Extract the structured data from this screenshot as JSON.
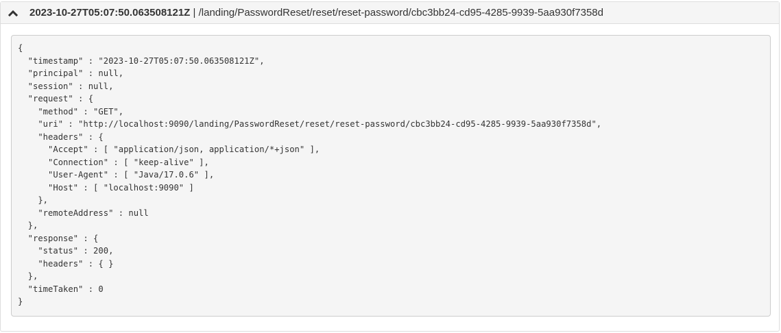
{
  "trace": {
    "timestamp": "2023-10-27T05:07:50.063508121Z",
    "separator": "|",
    "path": "/landing/PasswordReset/reset/reset-password/cbc3bb24-cd95-4285-9939-5aa930f7358d",
    "expanded": true,
    "icon": "chevron-up-icon",
    "json_text": "{\n  \"timestamp\" : \"2023-10-27T05:07:50.063508121Z\",\n  \"principal\" : null,\n  \"session\" : null,\n  \"request\" : {\n    \"method\" : \"GET\",\n    \"uri\" : \"http://localhost:9090/landing/PasswordReset/reset/reset-password/cbc3bb24-cd95-4285-9939-5aa930f7358d\",\n    \"headers\" : {\n      \"Accept\" : [ \"application/json, application/*+json\" ],\n      \"Connection\" : [ \"keep-alive\" ],\n      \"User-Agent\" : [ \"Java/17.0.6\" ],\n      \"Host\" : [ \"localhost:9090\" ]\n    },\n    \"remoteAddress\" : null\n  },\n  \"response\" : {\n    \"status\" : 200,\n    \"headers\" : { }\n  },\n  \"timeTaken\" : 0\n}"
  }
}
